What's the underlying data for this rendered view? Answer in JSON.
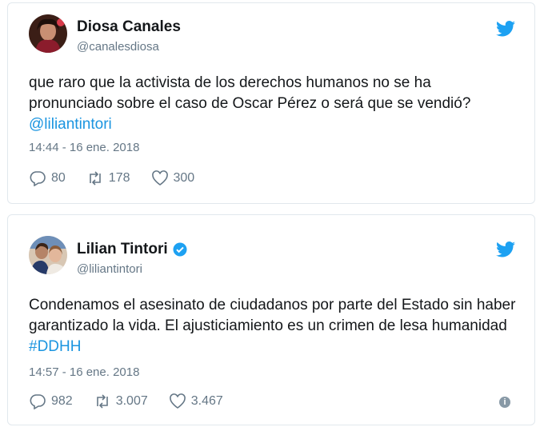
{
  "tweets": [
    {
      "display_name": "Diosa Canales",
      "handle": "@canalesdiosa",
      "text": "que raro que la activista de los derechos humanos no se ha pronunciado sobre el caso de Oscar Pérez o será que se vendió? ",
      "mention": "@liliantintori",
      "timestamp": "14:44 - 16 ene. 2018",
      "replies": "80",
      "retweets": "178",
      "likes": "300"
    },
    {
      "display_name": "Lilian Tintori",
      "handle": "@liliantintori",
      "text": "Condenamos el asesinato de ciudadanos por parte del Estado sin haber garantizado la vida. El ajusticiamiento es un crimen de lesa humanidad ",
      "hashtag": "#DDHH",
      "timestamp": "14:57 - 16 ene. 2018",
      "replies": "982",
      "retweets": "3.007",
      "likes": "3.467",
      "info_glyph": "i"
    }
  ],
  "colors": {
    "twitter_blue": "#1da1f2",
    "link_blue": "#1b95e0",
    "muted_gray": "#657786"
  },
  "icons": [
    "twitter-bird-icon",
    "verified-badge-icon",
    "reply-icon",
    "retweet-icon",
    "heart-icon",
    "info-icon"
  ]
}
